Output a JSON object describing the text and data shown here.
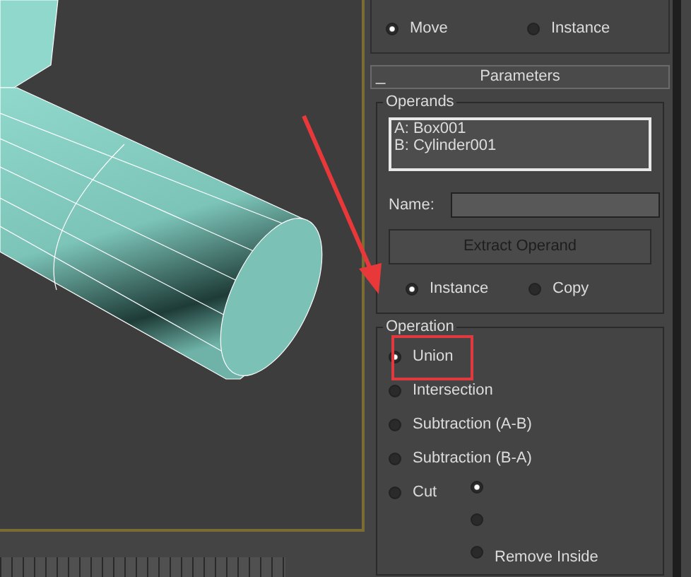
{
  "viewport": {
    "kind": "scene"
  },
  "clone_options": {
    "rows": [
      [
        {
          "label": "Move",
          "selected": true
        },
        {
          "label": "Instance",
          "selected": false
        }
      ]
    ]
  },
  "parameters": {
    "header": "Parameters",
    "collapse": "_",
    "operands": {
      "title": "Operands",
      "items": [
        "A: Box001",
        "B: Cylinder001"
      ],
      "name_label": "Name:",
      "extract_button": "Extract Operand",
      "modes": [
        {
          "label": "Instance",
          "selected": true
        },
        {
          "label": "Copy",
          "selected": false
        }
      ]
    },
    "operation": {
      "title": "Operation",
      "options": [
        {
          "label": "Union",
          "selected": true
        },
        {
          "label": "Intersection",
          "selected": false
        },
        {
          "label": "Subtraction (A-B)",
          "selected": false
        },
        {
          "label": "Subtraction (B-A)",
          "selected": false
        },
        {
          "label": "Cut",
          "selected": false
        }
      ],
      "cut_options": [
        {
          "selected": true
        },
        {
          "selected": false
        },
        {
          "label": "Remove Inside",
          "selected": false
        }
      ]
    }
  },
  "annotations": {
    "arrow": true,
    "highlight": true
  }
}
